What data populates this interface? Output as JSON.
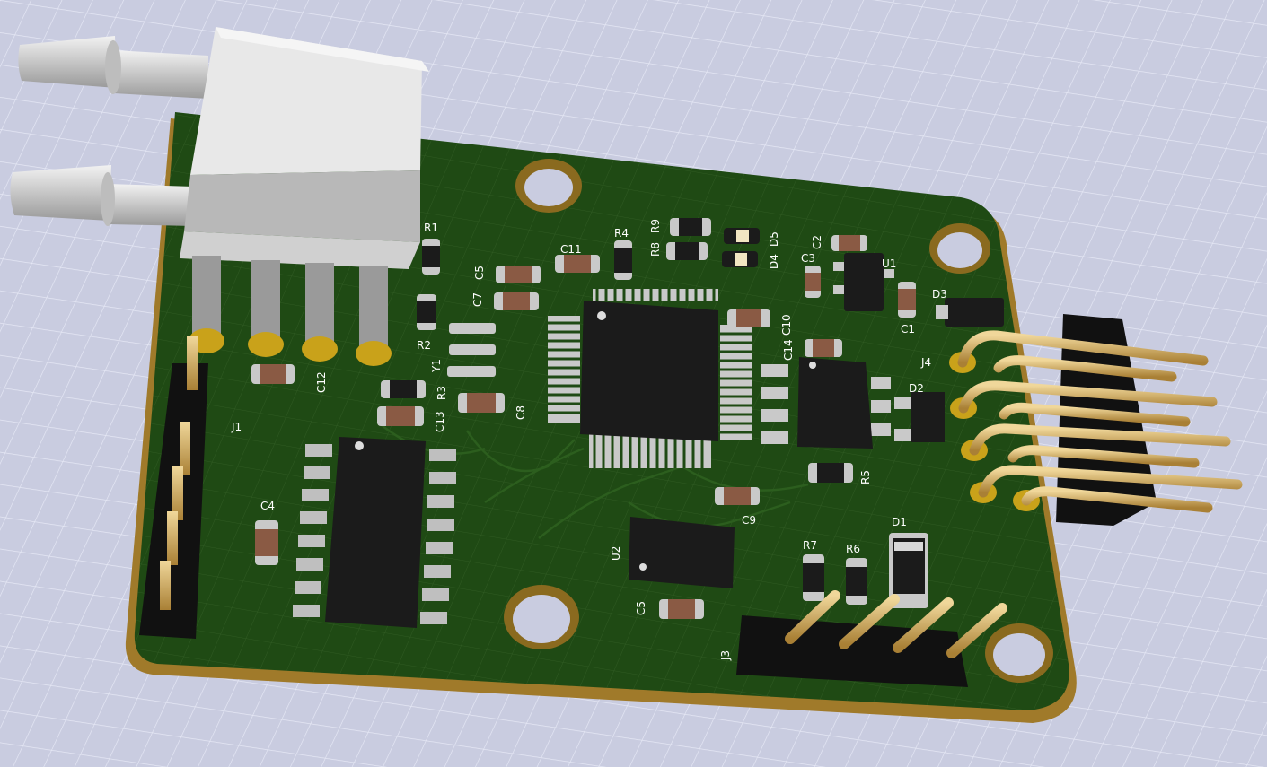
{
  "colors": {
    "background": "#c9cce0",
    "grid": "#eef0fb",
    "board": "#1f4a14",
    "board_edge": "#a07a2a",
    "silkscreen": "#ffffff",
    "pad": "#c9a21a",
    "ic_body": "#1b1b1b",
    "sensor_body": "#d9d9d9"
  },
  "references": {
    "r1": "R1",
    "r2": "R2",
    "r3": "R3",
    "r4": "R4",
    "r5": "R5",
    "r6": "R6",
    "r7": "R7",
    "r8": "R8",
    "r9": "R9",
    "c1": "C1",
    "c2": "C2",
    "c3": "C3",
    "c4": "C4",
    "c5_top": "C5",
    "c5_bottom": "C5",
    "c7": "C7",
    "c8": "C8",
    "c9": "C9",
    "c10": "C10",
    "c11": "C11",
    "c12": "C12",
    "c13": "C13",
    "c14": "C14",
    "d1": "D1",
    "d2": "D2",
    "d3": "D3",
    "d4": "D4",
    "d5": "D5",
    "u1": "U1",
    "u2": "U2",
    "y1": "Y1",
    "j1": "J1",
    "j3": "J3",
    "j4": "J4"
  }
}
